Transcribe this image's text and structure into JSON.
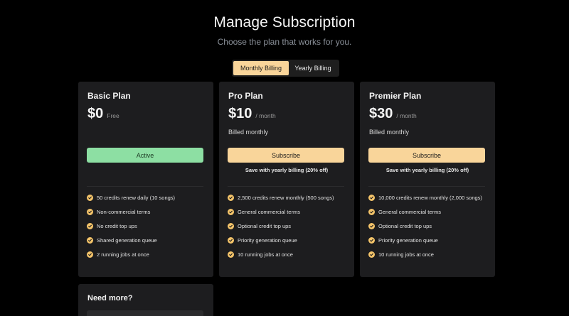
{
  "header": {
    "title": "Manage Subscription",
    "subtitle": "Choose the plan that works for you."
  },
  "billing_toggle": {
    "options": [
      "Monthly Billing",
      "Yearly Billing"
    ],
    "selected": "Monthly Billing"
  },
  "plans": [
    {
      "name": "Basic Plan",
      "price": "$0",
      "price_suffix": "Free",
      "billed_note": "",
      "button_label": "Active",
      "button_color": "#8ddfa3",
      "save_note": "",
      "features": [
        "50 credits renew daily (10 songs)",
        "Non-commercial terms",
        "No credit top ups",
        "Shared generation queue",
        "2 running jobs at once"
      ]
    },
    {
      "name": "Pro Plan",
      "price": "$10",
      "price_suffix": "/ month",
      "billed_note": "Billed monthly",
      "button_label": "Subscribe",
      "button_color": "#f9d59a",
      "save_note": "Save with yearly billing (20% off)",
      "features": [
        "2,500 credits renew monthly (500 songs)",
        "General commercial terms",
        "Optional credit top ups",
        "Priority generation queue",
        "10 running jobs at once"
      ]
    },
    {
      "name": "Premier Plan",
      "price": "$30",
      "price_suffix": "/ month",
      "billed_note": "Billed monthly",
      "button_label": "Subscribe",
      "button_color": "#f9d59a",
      "save_note": "Save with yearly billing (20% off)",
      "features": [
        "10,000 credits renew monthly (2,000 songs)",
        "General commercial terms",
        "Optional credit top ups",
        "Priority generation queue",
        "10 running jobs at once"
      ]
    }
  ],
  "need_more": {
    "title": "Need more?"
  },
  "colors": {
    "background": "#000000",
    "card": "#1d1d1f",
    "accent_yellow": "#f9d59a",
    "accent_green": "#8ddfa3",
    "check": "#f4c46a"
  },
  "icons": {
    "feature_check": "check-circle-icon"
  }
}
